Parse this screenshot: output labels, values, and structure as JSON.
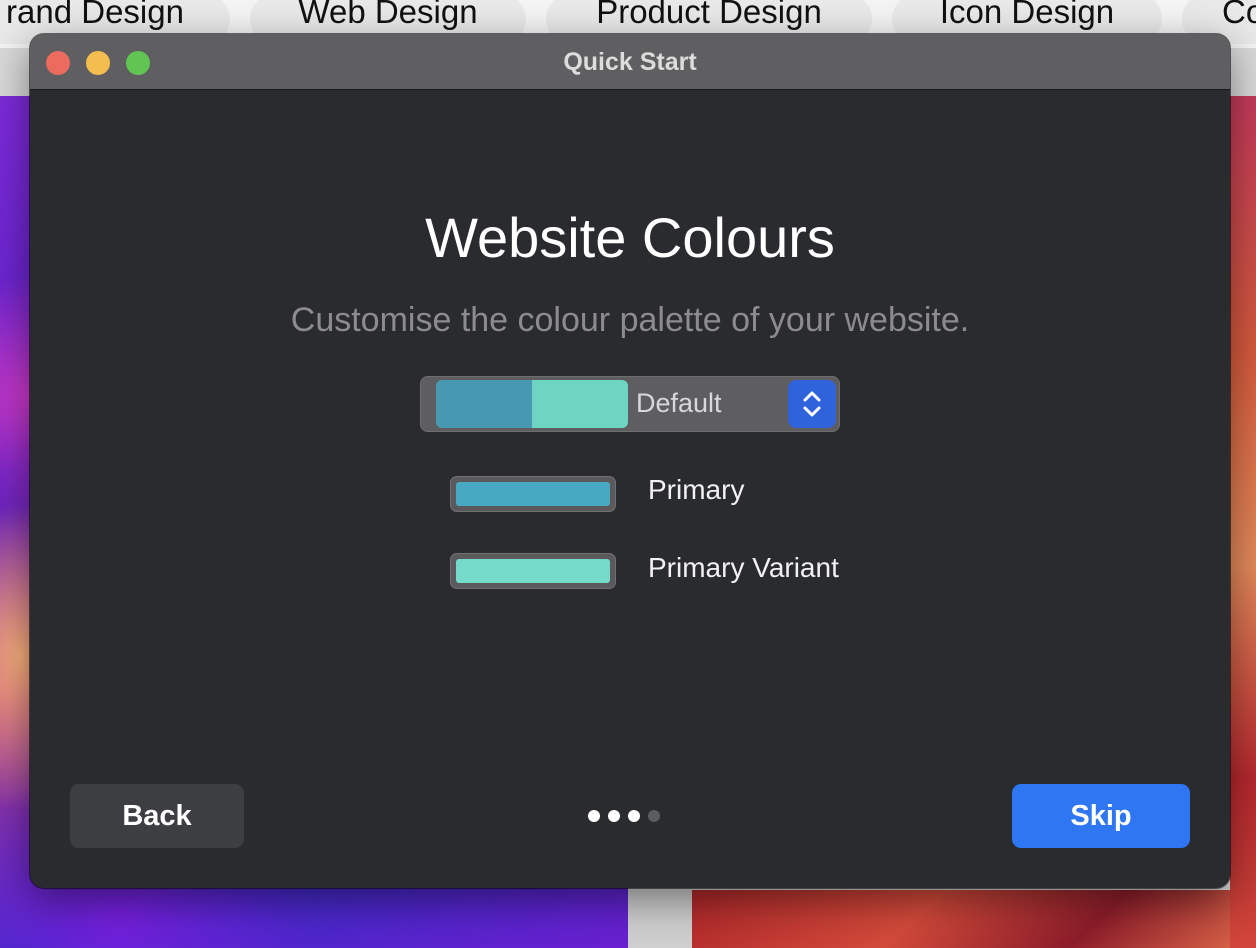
{
  "background_tabs": [
    {
      "label": "rand Design"
    },
    {
      "label": "Web Design"
    },
    {
      "label": "Product Design"
    },
    {
      "label": "Icon Design"
    },
    {
      "label": "Co"
    }
  ],
  "window": {
    "title": "Quick Start"
  },
  "page": {
    "heading": "Website Colours",
    "subheading": "Customise the colour palette of your website."
  },
  "palette": {
    "selected": "Default",
    "swatch_colors": [
      "#4799b3",
      "#6dd5c1"
    ]
  },
  "colors": [
    {
      "label": "Primary",
      "value": "#47a9c2"
    },
    {
      "label": "Primary Variant",
      "value": "#74dbca"
    }
  ],
  "footer": {
    "back_label": "Back",
    "skip_label": "Skip",
    "steps_total": 4,
    "current_step": 3
  },
  "theme": {
    "accent": "#2f76f2",
    "window_bg": "#2a2b2e"
  }
}
